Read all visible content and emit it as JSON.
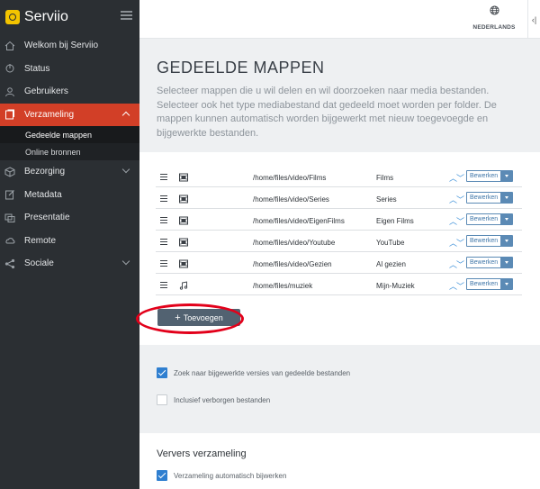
{
  "app": {
    "name": "Serviio"
  },
  "sidebar": {
    "items": [
      {
        "label": "Welkom bij Serviio",
        "icon": "home-icon"
      },
      {
        "label": "Status",
        "icon": "status-icon"
      },
      {
        "label": "Gebruikers",
        "icon": "user-icon"
      },
      {
        "label": "Verzameling",
        "icon": "library-icon",
        "active": true,
        "expanded": true
      },
      {
        "label": "Bezorging",
        "icon": "box-icon"
      },
      {
        "label": "Metadata",
        "icon": "edit-icon"
      },
      {
        "label": "Presentatie",
        "icon": "presentation-icon"
      },
      {
        "label": "Remote",
        "icon": "cloud-icon"
      },
      {
        "label": "Sociale",
        "icon": "share-icon"
      }
    ],
    "subitems": [
      {
        "label": "Gedeelde mappen",
        "active": true
      },
      {
        "label": "Online bronnen"
      }
    ]
  },
  "topbar": {
    "language": "NEDERLANDS",
    "collapse_glyph": "‹|"
  },
  "header": {
    "title": "GEDEELDE MAPPEN",
    "description": "Selecteer mappen die u wil delen en wil doorzoeken naar media bestanden. Selecteer ook het type mediabestand dat gedeeld moet worden per folder. De mappen kunnen automatisch worden bijgewerkt met nieuw toegevoegde en bijgewerkte bestanden."
  },
  "folders": {
    "rows": [
      {
        "type": "video",
        "path": "/home/files/video/Films",
        "name": "Films"
      },
      {
        "type": "video",
        "path": "/home/files/video/Series",
        "name": "Series"
      },
      {
        "type": "video",
        "path": "/home/files/video/EigenFilms",
        "name": "Eigen Films"
      },
      {
        "type": "video",
        "path": "/home/files/video/Youtube",
        "name": "YouTube"
      },
      {
        "type": "video",
        "path": "/home/files/video/Gezien",
        "name": "Al gezien"
      },
      {
        "type": "music",
        "path": "/home/files/muziek",
        "name": "Mijn-Muziek"
      }
    ],
    "edit_label": "Bewerken",
    "move_arrows": "︿﹀",
    "add_label": "Toevoegen"
  },
  "options": {
    "search_updated": {
      "label": "Zoek naar bijgewerkte versies van gedeelde bestanden",
      "checked": true
    },
    "include_hidden": {
      "label": "Inclusief verborgen bestanden",
      "checked": false
    }
  },
  "refresh": {
    "title": "Ververs verzameling",
    "auto_update": {
      "label": "Verzameling automatisch bijwerken",
      "checked": true
    }
  },
  "colors": {
    "accent": "#d23f27",
    "sidebar": "#2b2f33",
    "link": "#3a8fd8",
    "highlight": "#e2001a"
  }
}
